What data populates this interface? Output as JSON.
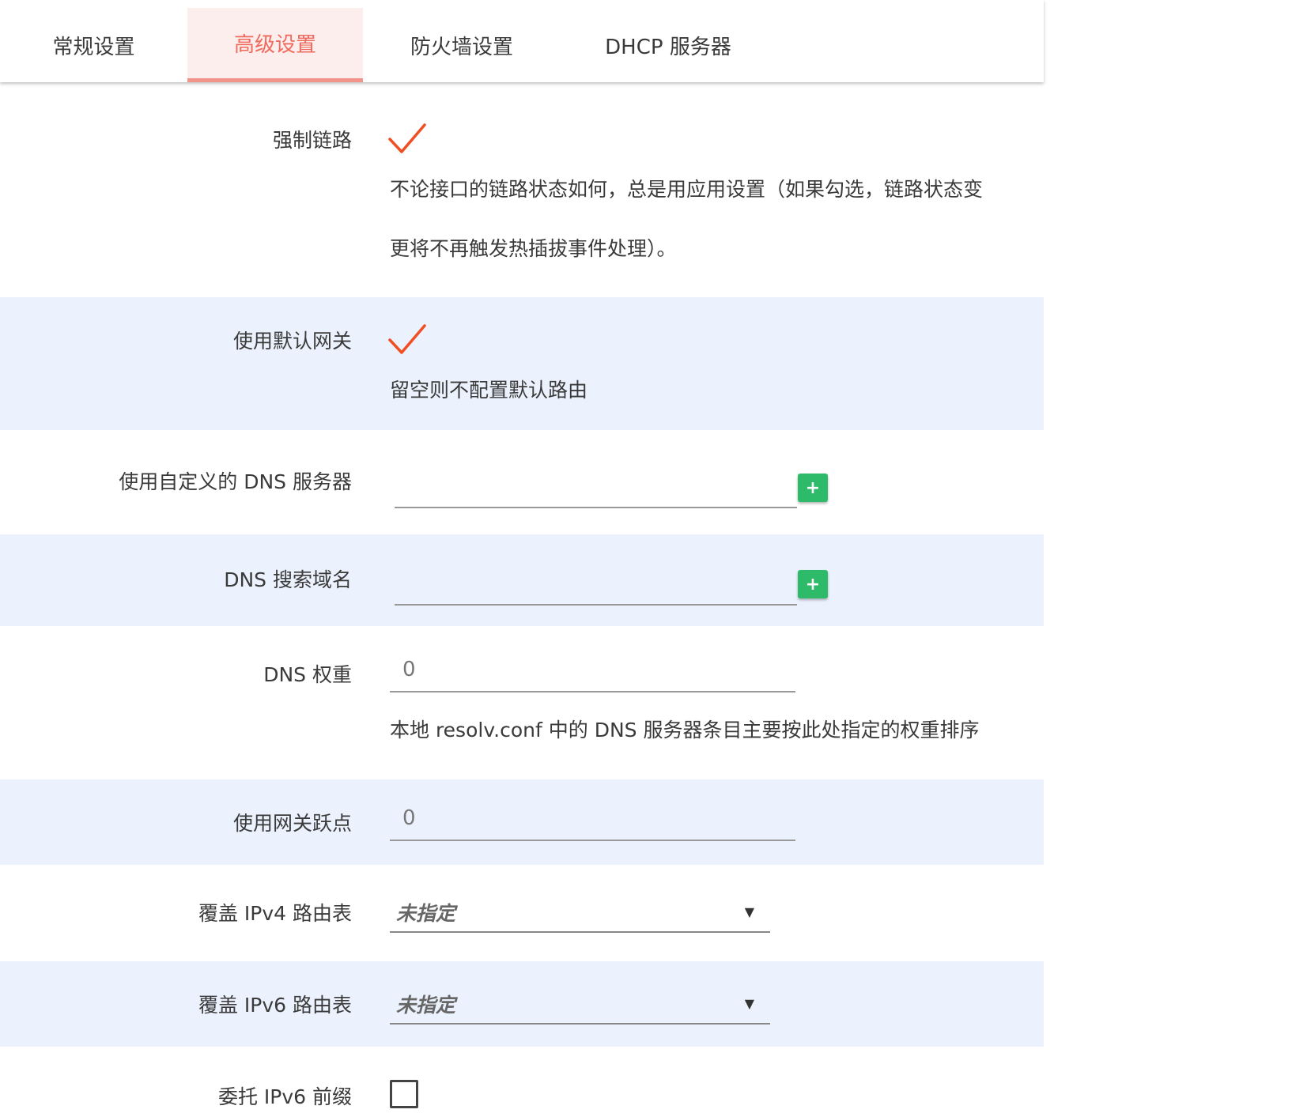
{
  "tabs": [
    {
      "label": "常规设置"
    },
    {
      "label": "高级设置"
    },
    {
      "label": "防火墙设置"
    },
    {
      "label": "DHCP 服务器"
    }
  ],
  "active_tab": "高级设置",
  "colors": {
    "accent": "#f06a5c",
    "check": "#f04e23",
    "row_alt": "#ebf2fd",
    "add_button": "#2dbb6a"
  },
  "fields": {
    "force_link": {
      "label": "强制链路",
      "checked": true,
      "desc_line1": "不论接口的链路状态如何，总是用应用设置（如果勾选，链路状态变",
      "desc_line2": "更将不再触发热插拔事件处理）。"
    },
    "default_gateway": {
      "label": "使用默认网关",
      "checked": true,
      "desc": "留空则不配置默认路由"
    },
    "custom_dns": {
      "label": "使用自定义的 DNS 服务器",
      "value": "",
      "add_label": "+"
    },
    "dns_search": {
      "label": "DNS 搜索域名",
      "value": "",
      "add_label": "+"
    },
    "dns_weight": {
      "label": "DNS 权重",
      "value": "0",
      "desc": "本地 resolv.conf 中的 DNS 服务器条目主要按此处指定的权重排序"
    },
    "gateway_metric": {
      "label": "使用网关跃点",
      "value": "0"
    },
    "ipv4_table": {
      "label": "覆盖 IPv4 路由表",
      "selected": "未指定"
    },
    "ipv6_table": {
      "label": "覆盖 IPv6 路由表",
      "selected": "未指定"
    },
    "delegate_ipv6": {
      "label": "委托 IPv6 前缀",
      "checked": false
    }
  }
}
